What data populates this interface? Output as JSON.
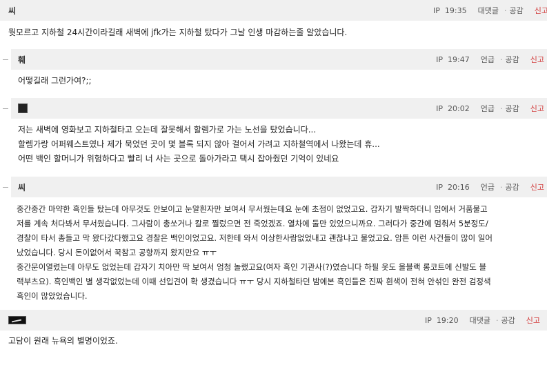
{
  "comments": [
    {
      "nick": "씨",
      "ip": "IP",
      "time": "19:35",
      "action": "대댓글",
      "like": "공감",
      "report": "신고",
      "lines": [
        "뭣모르고 지하철 24시간이라길래 새벽에 jfk가는 지하철 탔다가 그날 인생 마감하는줄 알았습니다."
      ]
    },
    {
      "nick": "훼",
      "ip": "IP",
      "time": "19:47",
      "action": "언급",
      "like": "공감",
      "report": "신고",
      "lines": [
        "어떻길래 그런가여?;;"
      ]
    },
    {
      "nick": "",
      "ip": "IP",
      "time": "20:02",
      "action": "언급",
      "like": "공감",
      "report": "신고",
      "lines": [
        "저는 새벽에 영화보고 지하철타고 오는데 잘못해서 할렘가로 가는 노선을 탔었습니다...",
        "할렘가랑 어퍼웨스트였나 제가 묵었던 곳이 몇 블록 되지 않아 걸어서 가려고 지하철역에서 나왔는데 휴...",
        "어떤 백인 할머니가 위험하다고 빨리 너 사는 곳으로 돌아가라고 택시 잡아줬던 기억이 있네요"
      ]
    },
    {
      "nick": "씨",
      "ip": "IP",
      "time": "20:16",
      "action": "언급",
      "like": "공감",
      "report": "신고",
      "lines": [
        "중간중간 마약한 흑인들 탔는데 아무것도 안보이고 눈알흰자만 보여서 무서웠는데요 눈에 초점이 없었고요. 갑자기 발짝하더니 입에서 거품물고",
        "저를 계속 처다봐서 무서웠습니다. 그사람이 총쏘거나 칼로 찔렀으면 전 죽었겠죠. 열차에 둘만 있었으니까요. 그러다가 중간에 멈춰서 5분정도/",
        "경찰이 타서 총들고 막 왔다갔다했고요 경찰은 백인이었고요. 저한테 와서 이상한사람없었내고 괜찮냐고 물었고요. 암튼 이런 사건들이 많이 일어",
        "났었습니다. 당시 돈이없어서 꾹참고 공항까지 왔지만요 ㅠㅜ",
        "중간문이열렸는데 아무도 없었는데 갑자기 치아만 딱 보여서 엄청 놀랬고요(여자 흑인 기관사(?)였습니다 하필 옷도 올블랙 롱코트에 신발도 블",
        "랙부츠요). 흑인백인 별 생각없었는데 이때 선입견이 확 생겼습니다 ㅠㅜ 당시 지하철타던 밤에본 흑인들은 진짜 흰색이 전혀 안섞인 완전 검정색",
        "흑인이 많았었습니다."
      ]
    },
    {
      "nick": "",
      "ip": "IP",
      "time": "19:20",
      "action": "대댓글",
      "like": "공감",
      "report": "신고",
      "lines": [
        "고담이 원래 뉴욕의 별명이었죠."
      ]
    }
  ]
}
